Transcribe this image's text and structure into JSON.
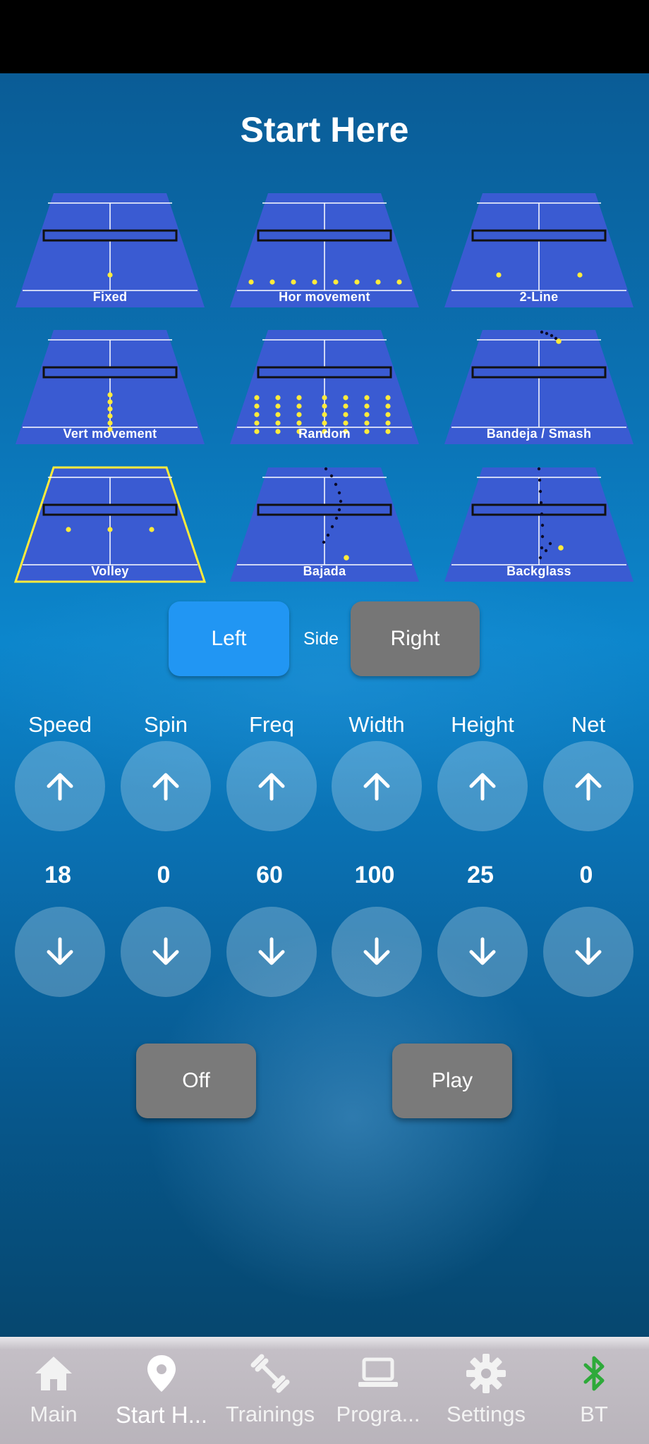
{
  "header": {
    "title": "Start Here"
  },
  "drills": [
    {
      "label": "Fixed",
      "selected": false
    },
    {
      "label": "Hor movement",
      "selected": false
    },
    {
      "label": "2-Line",
      "selected": false
    },
    {
      "label": "Vert movement",
      "selected": false
    },
    {
      "label": "Random",
      "selected": false
    },
    {
      "label": "Bandeja / Smash",
      "selected": false
    },
    {
      "label": "Volley",
      "selected": true
    },
    {
      "label": "Bajada",
      "selected": false
    },
    {
      "label": "Backglass",
      "selected": false
    }
  ],
  "side": {
    "label": "Side",
    "left_label": "Left",
    "right_label": "Right",
    "selected": "Left",
    "active_color": "#2196f3",
    "inactive_color": "#767676"
  },
  "controls": [
    {
      "label": "Speed",
      "value": "18"
    },
    {
      "label": "Spin",
      "value": "0"
    },
    {
      "label": "Freq",
      "value": "60"
    },
    {
      "label": "Width",
      "value": "100"
    },
    {
      "label": "Height",
      "value": "25"
    },
    {
      "label": "Net",
      "value": "0"
    }
  ],
  "actions": {
    "off_label": "Off",
    "play_label": "Play"
  },
  "nav": [
    {
      "label": "Main",
      "icon": "home-icon",
      "active": false
    },
    {
      "label": "Start H...",
      "icon": "location-pin-icon",
      "active": true
    },
    {
      "label": "Trainings",
      "icon": "dumbbell-icon",
      "active": false
    },
    {
      "label": "Progra...",
      "icon": "laptop-icon",
      "active": false
    },
    {
      "label": "Settings",
      "icon": "gear-icon",
      "active": false
    },
    {
      "label": "BT",
      "icon": "bluetooth-icon",
      "active": false,
      "color": "#2eaa3a"
    }
  ],
  "colors": {
    "court": "#3a5bd2",
    "court_line": "#ffffff",
    "ball": "#ffeb3b",
    "selected_border": "#ffeb3b"
  }
}
